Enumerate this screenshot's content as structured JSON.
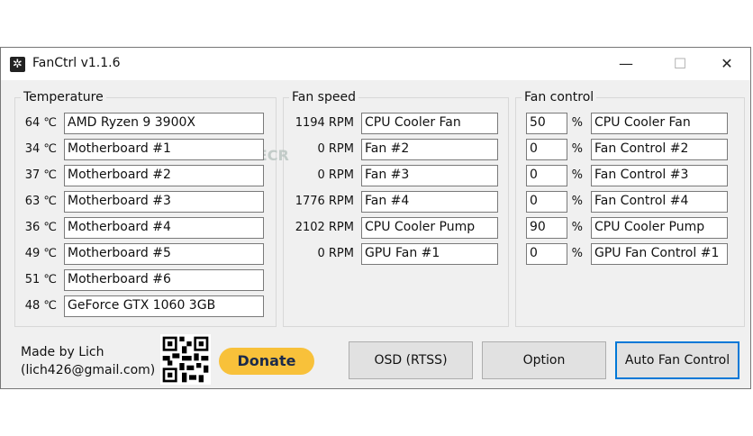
{
  "window": {
    "title": "FanCtrl v1.1.6",
    "minimize": "—",
    "maximize": "☐",
    "close": "✕"
  },
  "temperature": {
    "label": "Temperature",
    "items": [
      {
        "value": "64 ℃",
        "name": "AMD Ryzen 9 3900X"
      },
      {
        "value": "34 ℃",
        "name": "Motherboard #1"
      },
      {
        "value": "37 ℃",
        "name": "Motherboard #2"
      },
      {
        "value": "63 ℃",
        "name": "Motherboard #3"
      },
      {
        "value": "36 ℃",
        "name": "Motherboard #4"
      },
      {
        "value": "49 ℃",
        "name": "Motherboard #5"
      },
      {
        "value": "51 ℃",
        "name": "Motherboard #6"
      },
      {
        "value": "48 ℃",
        "name": "GeForce GTX 1060 3GB"
      }
    ]
  },
  "fan_speed": {
    "label": "Fan speed",
    "items": [
      {
        "value": "1194 RPM",
        "name": "CPU Cooler Fan"
      },
      {
        "value": "0 RPM",
        "name": "Fan #2"
      },
      {
        "value": "0 RPM",
        "name": "Fan #3"
      },
      {
        "value": "1776 RPM",
        "name": "Fan #4"
      },
      {
        "value": "2102 RPM",
        "name": "CPU Cooler Pump"
      },
      {
        "value": "0 RPM",
        "name": "GPU Fan #1"
      }
    ]
  },
  "fan_control": {
    "label": "Fan control",
    "unit": "%",
    "items": [
      {
        "value": "50",
        "name": "CPU Cooler Fan"
      },
      {
        "value": "0",
        "name": "Fan Control #2"
      },
      {
        "value": "0",
        "name": "Fan Control #3"
      },
      {
        "value": "0",
        "name": "Fan Control #4"
      },
      {
        "value": "90",
        "name": "CPU Cooler Pump"
      },
      {
        "value": "0",
        "name": "GPU Fan Control #1"
      }
    ]
  },
  "footer": {
    "made_by": "Made by Lich",
    "email": "(lich426@gmail.com)",
    "donate": "Donate",
    "osd": "OSD (RTSS)",
    "option": "Option",
    "auto": "Auto Fan Control"
  },
  "watermark": "FILECR"
}
